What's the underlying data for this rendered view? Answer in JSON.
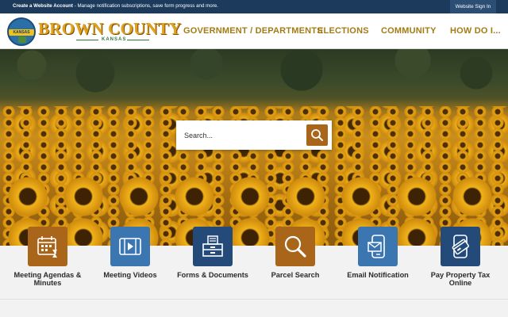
{
  "topbar": {
    "account_link": "Create a Website Account",
    "account_desc": " - Manage notification subscriptions, save form progress and more.",
    "signin_label": "Website Sign In"
  },
  "header": {
    "brand_name": "BROWN COUNTY",
    "brand_state": "KANSAS",
    "seal_text": "KANSAS"
  },
  "nav": {
    "items": [
      "GOVERNMENT / DEPARTMENTS",
      "ELECTIONS",
      "COMMUNITY",
      "HOW DO I..."
    ]
  },
  "search": {
    "placeholder": "Search..."
  },
  "quick_links": [
    {
      "label": "Meeting Agendas & Minutes",
      "icon": "calendar-icon",
      "color": "#a9661b"
    },
    {
      "label": "Meeting Videos",
      "icon": "video-icon",
      "color": "#3b76b0"
    },
    {
      "label": "Forms & Documents",
      "icon": "file-cabinet-icon",
      "color": "#234a78"
    },
    {
      "label": "Parcel Search",
      "icon": "magnifier-icon",
      "color": "#a9661b"
    },
    {
      "label": "Email Notification",
      "icon": "email-phone-icon",
      "color": "#3b76b0"
    },
    {
      "label": "Pay Property Tax Online",
      "icon": "payment-card-icon",
      "color": "#234a78"
    }
  ],
  "colors": {
    "topbar": "#1b3a5c",
    "nav_text": "#a37b16",
    "accent_orange": "#a9661b",
    "accent_blue": "#3b76b0",
    "accent_navy": "#234a78"
  }
}
